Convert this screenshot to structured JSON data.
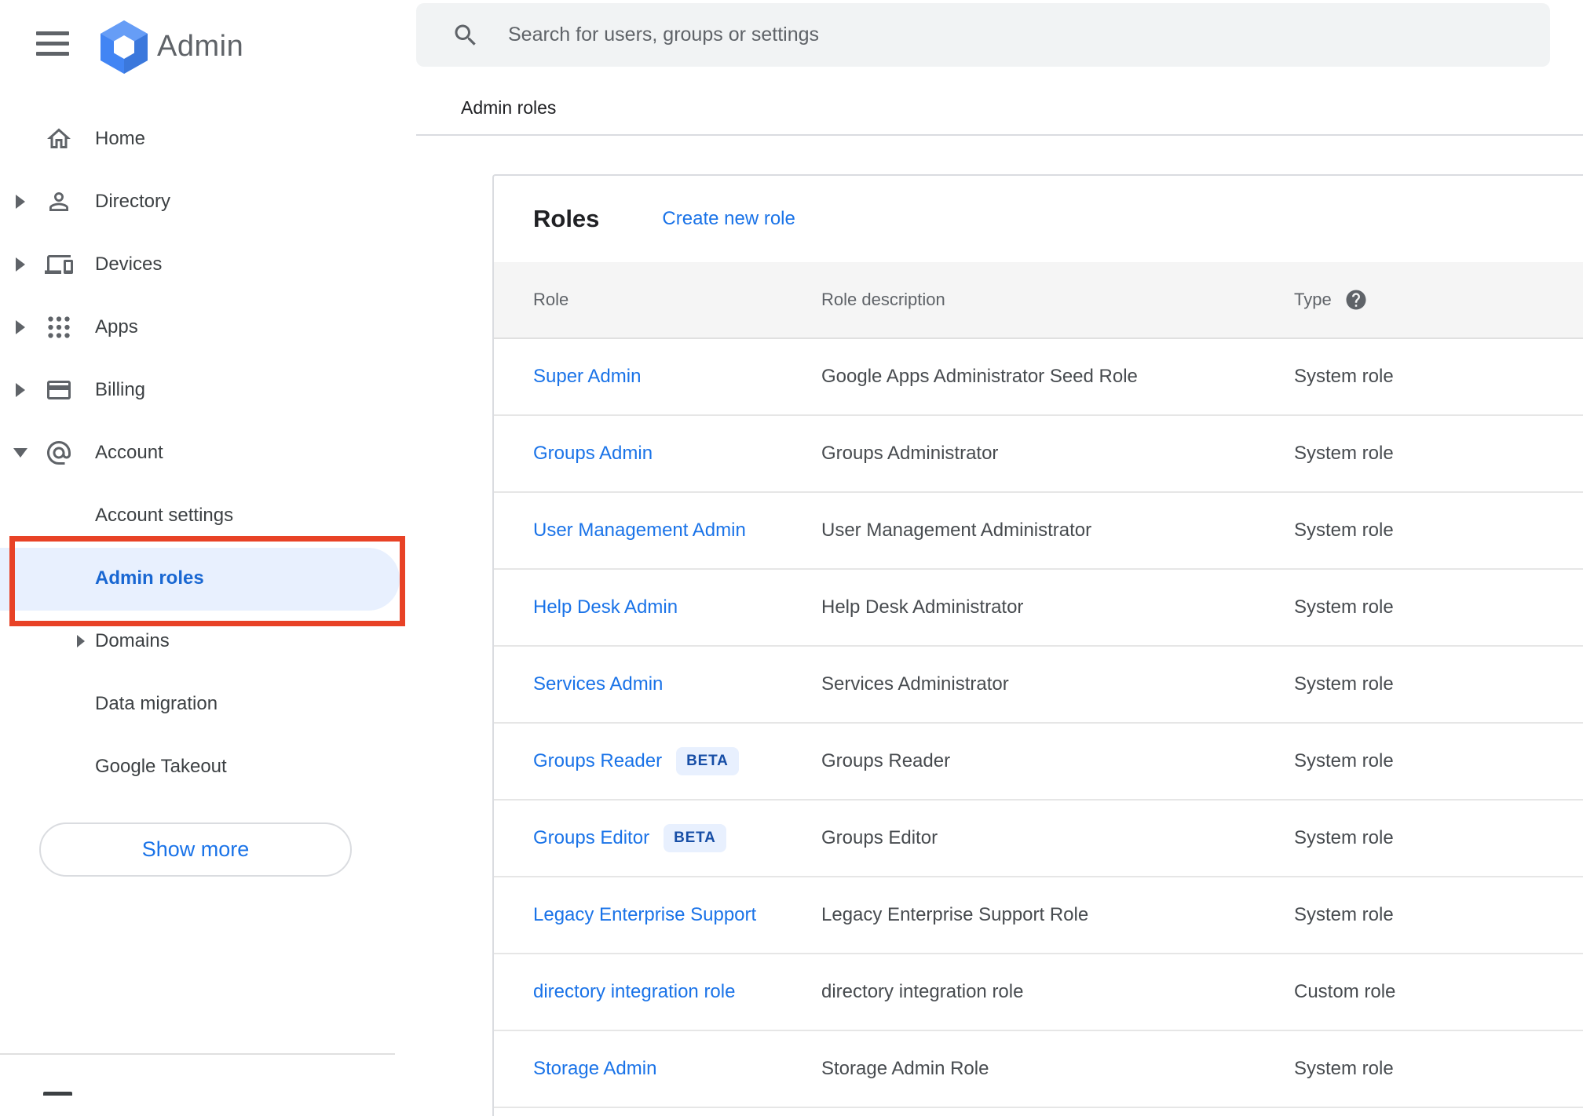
{
  "header": {
    "product_name": "Admin",
    "search": {
      "placeholder": "Search for users, groups or settings"
    }
  },
  "breadcrumb": {
    "label": "Admin roles"
  },
  "sidebar": {
    "items": [
      {
        "label": "Home",
        "icon": "home-icon",
        "expandable": false,
        "expanded": false
      },
      {
        "label": "Directory",
        "icon": "person-icon",
        "expandable": true,
        "expanded": false
      },
      {
        "label": "Devices",
        "icon": "devices-icon",
        "expandable": true,
        "expanded": false
      },
      {
        "label": "Apps",
        "icon": "apps-grid-icon",
        "expandable": true,
        "expanded": false
      },
      {
        "label": "Billing",
        "icon": "credit-card-icon",
        "expandable": true,
        "expanded": false
      },
      {
        "label": "Account",
        "icon": "at-sign-icon",
        "expandable": true,
        "expanded": true
      }
    ],
    "account_subitems": [
      {
        "label": "Account settings",
        "selected": false,
        "expandable": false
      },
      {
        "label": "Admin roles",
        "selected": true,
        "expandable": false
      },
      {
        "label": "Domains",
        "selected": false,
        "expandable": true
      },
      {
        "label": "Data migration",
        "selected": false,
        "expandable": false
      },
      {
        "label": "Google Takeout",
        "selected": false,
        "expandable": false
      }
    ],
    "show_more_label": "Show more",
    "selected_item_annotated": true
  },
  "content": {
    "panel_title": "Roles",
    "create_link": "Create new role",
    "table": {
      "columns": [
        "Role",
        "Role description",
        "Type"
      ],
      "beta_badge_label": "BETA",
      "rows": [
        {
          "role": "Super Admin",
          "beta": false,
          "description": "Google Apps Administrator Seed Role",
          "type": "System role"
        },
        {
          "role": "Groups Admin",
          "beta": false,
          "description": "Groups Administrator",
          "type": "System role"
        },
        {
          "role": "User Management Admin",
          "beta": false,
          "description": "User Management Administrator",
          "type": "System role"
        },
        {
          "role": "Help Desk Admin",
          "beta": false,
          "description": "Help Desk Administrator",
          "type": "System role"
        },
        {
          "role": "Services Admin",
          "beta": false,
          "description": "Services Administrator",
          "type": "System role"
        },
        {
          "role": "Groups Reader",
          "beta": true,
          "description": "Groups Reader",
          "type": "System role"
        },
        {
          "role": "Groups Editor",
          "beta": true,
          "description": "Groups Editor",
          "type": "System role"
        },
        {
          "role": "Legacy Enterprise Support",
          "beta": false,
          "description": "Legacy Enterprise Support Role",
          "type": "System role"
        },
        {
          "role": "directory integration role",
          "beta": false,
          "description": "directory integration role",
          "type": "Custom role"
        },
        {
          "role": "Storage Admin",
          "beta": false,
          "description": "Storage Admin Role",
          "type": "System role"
        }
      ]
    }
  },
  "colors": {
    "link_blue": "#1a73e8",
    "selected_blue": "#1967d2",
    "selected_pill_bg": "#e8f0fe",
    "annotation_red": "#e84226",
    "beta_text": "#174ea6",
    "beta_bg": "#e8f0fe",
    "table_header_bg": "#f5f5f5",
    "search_bg": "#f1f3f4",
    "icon_gray": "#5f6368",
    "text_dark": "#202124"
  }
}
